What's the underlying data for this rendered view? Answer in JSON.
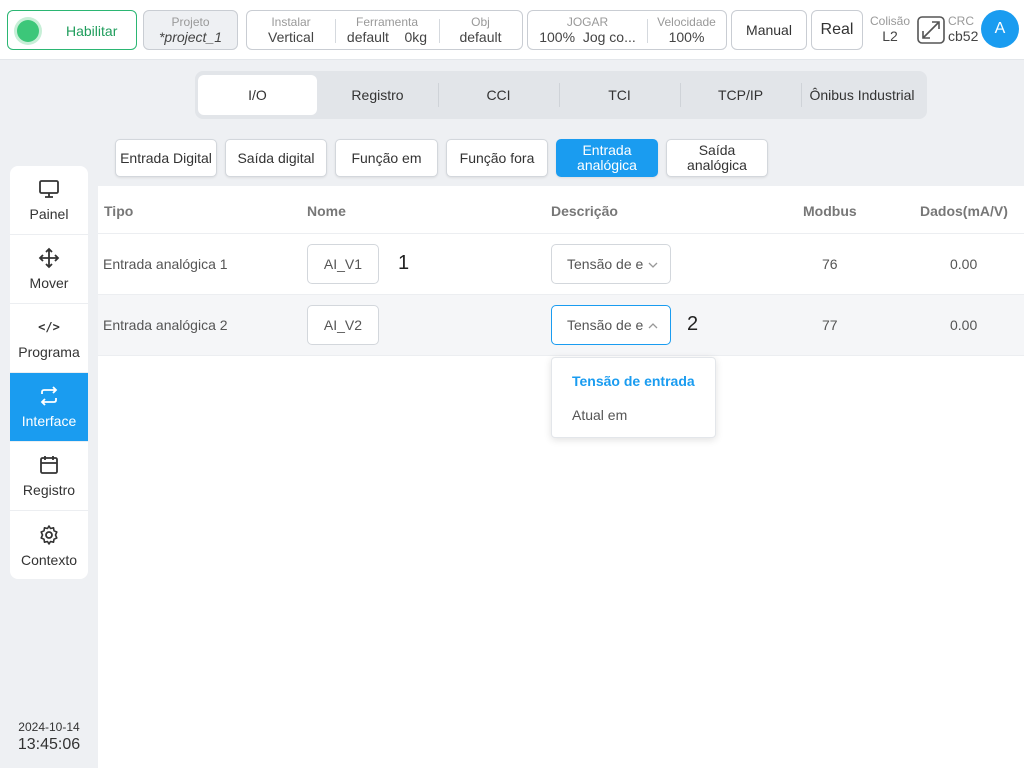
{
  "topbar": {
    "enable_label": "Habilitar",
    "project": {
      "caption": "Projeto",
      "value": "*project_1"
    },
    "install": [
      {
        "caption": "Instalar",
        "value": "Vertical"
      },
      {
        "caption": "Ferramenta",
        "value": "default    0kg"
      },
      {
        "caption": "Obj",
        "value": "default"
      }
    ],
    "jog": [
      {
        "caption": "JOGAR",
        "value": "100%  Jog co..."
      },
      {
        "caption": "Velocidade",
        "value": "100%"
      }
    ],
    "manual_label": "Manual",
    "real_label": "Real",
    "collision": {
      "caption": "Colisão",
      "value": "L2"
    },
    "crc": {
      "caption": "CRC",
      "value": "cb52"
    },
    "avatar_letter": "A"
  },
  "sidebar": {
    "items": [
      {
        "label": "Painel",
        "icon": "monitor-icon"
      },
      {
        "label": "Mover",
        "icon": "move-icon"
      },
      {
        "label": "Programa",
        "icon": "code-icon",
        "glyph": "</>"
      },
      {
        "label": "Interface",
        "icon": "swap-icon"
      },
      {
        "label": "Registro",
        "icon": "calendar-icon"
      },
      {
        "label": "Contexto",
        "icon": "gear-icon"
      }
    ],
    "active_index": 3
  },
  "clock": {
    "date": "2024-10-14",
    "time": "13:45:06"
  },
  "tabs": [
    "I/O",
    "Registro",
    "CCI",
    "TCI",
    "TCP/IP",
    "Ônibus Industrial"
  ],
  "active_tab": "I/O",
  "subtabs": [
    "Entrada Digital",
    "Saída digital",
    "Função em",
    "Função fora",
    "Entrada analógica",
    "Saída analógica"
  ],
  "active_subtab": "Entrada analógica",
  "table": {
    "headers": {
      "tipo": "Tipo",
      "nome": "Nome",
      "descricao": "Descrição",
      "modbus": "Modbus",
      "dados": "Dados(mA/V)"
    },
    "rows": [
      {
        "tipo": "Entrada analógica 1",
        "nome": "AI_V1",
        "descricao": "Tensão de entrada",
        "annotation": "1",
        "modbus": "76",
        "dados": "0.00"
      },
      {
        "tipo": "Entrada analógica 2",
        "nome": "AI_V2",
        "descricao": "Tensão de entrada",
        "annotation": "2",
        "modbus": "77",
        "dados": "0.00"
      }
    ]
  },
  "dropdown": {
    "options": [
      "Tensão de entrada",
      "Atual em"
    ],
    "selected": "Tensão de entrada"
  },
  "colors": {
    "accent": "#1a9cf0",
    "enable_green": "#3cc779"
  }
}
